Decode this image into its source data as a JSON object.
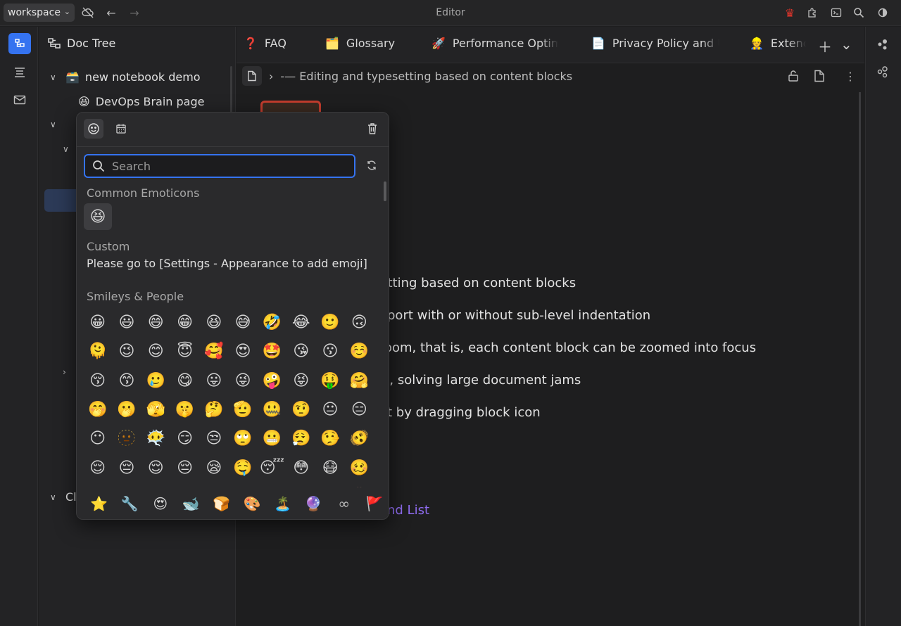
{
  "topbar": {
    "workspace": "workspace",
    "title": "Editor"
  },
  "tree": {
    "header": "Doc Tree",
    "items": [
      {
        "label": "new notebook demo",
        "icon": "🗃️"
      },
      {
        "label": "DevOps Brain page",
        "icon": "😆"
      },
      {
        "label": "Cl",
        "icon": ""
      }
    ]
  },
  "tabs": [
    {
      "icon": "❓",
      "label": "FAQ"
    },
    {
      "icon": "🗂️",
      "label": "Glossary"
    },
    {
      "icon": "🚀",
      "label": "Performance Optim"
    },
    {
      "icon": "📄",
      "label": "Privacy Policy and U"
    },
    {
      "icon": "👷",
      "label": "Extenc"
    }
  ],
  "editor": {
    "breadcrumb": "-— Editing and typesetting based on content blocks",
    "lines": [
      "setting based on content blocks",
      "port with or without sub-level indentation",
      "oom, that is, each content block can be zoomed into focus",
      "g, solving large document jams",
      "t by dragging block icon"
    ],
    "link": "nd List"
  },
  "emoji_picker": {
    "search_placeholder": "Search",
    "common_title": "Common Emoticons",
    "recent": "😆",
    "custom_title": "Custom",
    "custom_text": "Please go to [Settings - Appearance to add emoji]",
    "smileys_title": "Smileys & People",
    "emojis": [
      "😀",
      "😃",
      "😄",
      "😁",
      "😆",
      "😅",
      "🤣",
      "😂",
      "🙂",
      "🙃",
      "🫠",
      "😉",
      "😊",
      "😇",
      "🥰",
      "😍",
      "🤩",
      "😘",
      "😗",
      "☺️",
      "😚",
      "😙",
      "🥲",
      "😋",
      "😛",
      "😜",
      "🤪",
      "😝",
      "🤑",
      "🤗",
      "🤭",
      "🫢",
      "🫣",
      "🤫",
      "🤔",
      "🫡",
      "🤐",
      "🤨",
      "😐",
      "😑",
      "😶",
      "🫥",
      "😶‍🌫️",
      "😏",
      "😒",
      "🙄",
      "😬",
      "😮‍💨",
      "🤥",
      "🫨",
      "😌",
      "😔",
      "😌",
      "😔",
      "😪",
      "🤤",
      "😴",
      "😳",
      "😷",
      "🥴",
      "🤒",
      "🤕",
      "🤢",
      "🤮",
      "🤧",
      "🥵",
      "🥶",
      "😵",
      "🤯",
      "🤠"
    ],
    "categories": [
      "⭐",
      "🔧",
      "😍",
      "🐋",
      "🍞",
      "🎨",
      "🏝️",
      "🔮",
      "∞",
      "🚩"
    ]
  }
}
